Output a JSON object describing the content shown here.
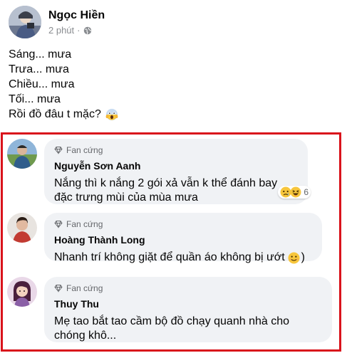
{
  "post": {
    "author": "Ngọc Hiền",
    "time": "2 phút",
    "separator": "·",
    "lines": [
      "Sáng... mưa",
      "Trưa... mưa",
      "Chiều... mưa",
      "Tối... mưa",
      "Rồi đồ đâu t mặc?"
    ]
  },
  "comments": [
    {
      "badge": "Fan cứng",
      "name": "Nguyễn Sơn Aanh",
      "lines": [
        "Nắng thì k nắng 2 gói xả vẫn k thể đánh bay",
        "đặc trưng mùi của mùa mưa"
      ],
      "reaction_count": "6"
    },
    {
      "badge": "Fan cứng",
      "name": "Hoàng Thành Long",
      "lines": [
        "Nhanh trí không giặt để quần áo không bị ướt",
        ")"
      ]
    },
    {
      "badge": "Fan cứng",
      "name": "Thuy Thu",
      "lines": [
        "Mẹ tao bắt tao cầm bộ đồ chạy quanh nhà cho",
        "chóng khô..."
      ]
    }
  ],
  "colors": {
    "highlight_border": "#d9121b",
    "bubble_bg": "#f0f2f5",
    "muted_text": "#65676b"
  },
  "icons": {
    "time_privacy": "globe-icon",
    "post_emoji": "scream-emoji-icon",
    "badge": "diamond-icon",
    "reactions": [
      "sad-emoji-icon",
      "haha-emoji-icon"
    ],
    "comment2_emoji": "smile-emoji-icon"
  }
}
